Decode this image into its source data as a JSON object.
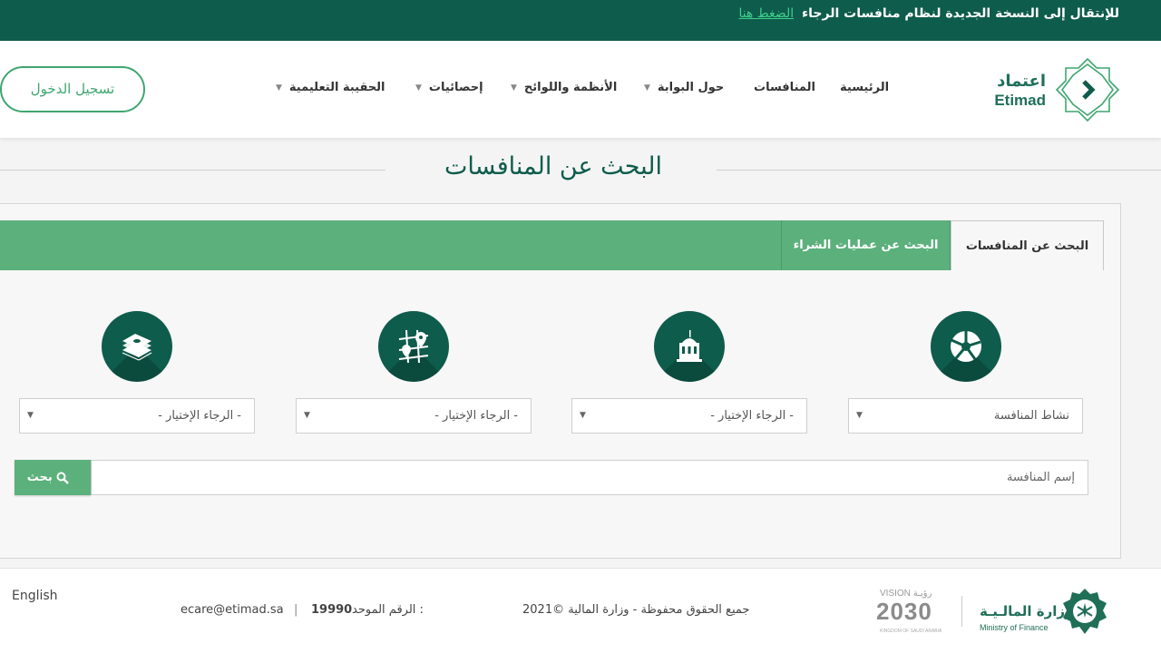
{
  "banner": {
    "text": "للإنتقال إلى النسخة الجديدة لنظام منافسات الرجاء",
    "link": "الضغط هنا"
  },
  "logo": {
    "ar": "اعتماد",
    "en": "Etimad"
  },
  "nav": {
    "home": "الرئيسية",
    "competitions": "المنافسات",
    "about": "حول البوابة",
    "regulations": "الأنظمة واللوائح",
    "statistics": "إحصائيات",
    "learning": "الحقيبة التعليمية",
    "login": "تسجيل الدخول"
  },
  "page": {
    "title": "البحث عن المنافسات"
  },
  "tabs": {
    "active": "البحث عن المنافسات",
    "second": "البحث عن عمليات الشراء"
  },
  "filters": {
    "activity": "نشاط المنافسة",
    "select2": "- الرجاء الإختيار -",
    "select3": "- الرجاء الإختيار -",
    "select4": "- الرجاء الإختيار -"
  },
  "search": {
    "placeholder": "إسم المنافسة",
    "button": "بحث"
  },
  "footer": {
    "email": "ecare@etimad.sa",
    "separator": "|",
    "unified_number_label": "الرقم الموحد :",
    "unified_number": "19990",
    "copyright": "جميع الحقوق محفوظة - وزارة المالية ©2021",
    "english": "English",
    "mof_ar": "وزارة المالـيـة",
    "mof_en": "Ministry of Finance",
    "vision_top": "VISION رؤيـة",
    "vision_num": "2030",
    "vision_sub": "KINGDOM OF SAUDI ARABIA"
  },
  "colors": {
    "primary_dark": "#0e5c4c",
    "primary_green": "#5cb07c",
    "link_green": "#3fcf8c"
  },
  "icons": [
    "shield-icon",
    "chevron-down-icon",
    "pie-chart-icon",
    "building-icon",
    "map-pin-icon",
    "money-stack-icon",
    "search-icon"
  ]
}
